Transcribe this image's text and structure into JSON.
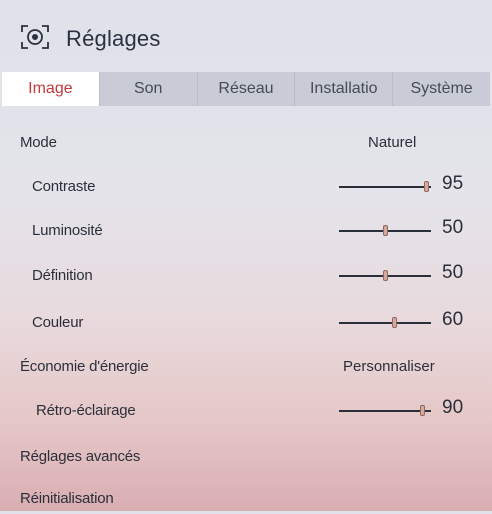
{
  "header": {
    "title": "Réglages",
    "icon": "settings-camera-icon"
  },
  "tabs": [
    {
      "label": "Image",
      "active": true
    },
    {
      "label": "Son",
      "active": false
    },
    {
      "label": "Réseau",
      "active": false
    },
    {
      "label": "Installatio",
      "active": false
    },
    {
      "label": "Système",
      "active": false
    }
  ],
  "colors": {
    "active_tab_text": "#c23a3a",
    "tab_bar": "#c9ccd6",
    "knob": "#d9a89c"
  },
  "settings": {
    "mode": {
      "label": "Mode",
      "value": "Naturel"
    },
    "contraste": {
      "label": "Contraste",
      "value": 95
    },
    "luminosite": {
      "label": "Luminosité",
      "value": 50
    },
    "definition": {
      "label": "Définition",
      "value": 50
    },
    "couleur": {
      "label": "Couleur",
      "value": 60
    },
    "economie": {
      "label": "Économie d'énergie",
      "value": "Personnaliser"
    },
    "retro": {
      "label": "Rétro-éclairage",
      "value": 90
    },
    "avances": {
      "label": "Réglages avancés"
    },
    "reinit": {
      "label": "Réinitialisation"
    }
  }
}
